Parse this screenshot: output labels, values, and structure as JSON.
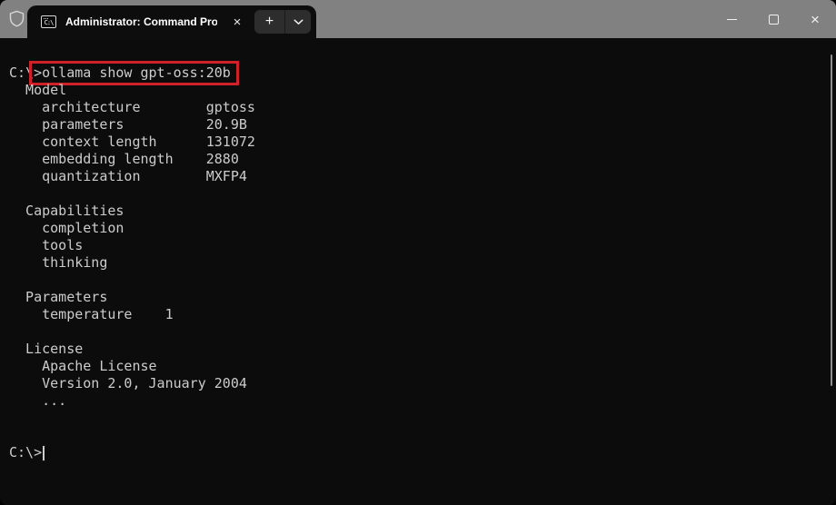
{
  "titlebar": {
    "tab": {
      "title": "Administrator: Command Pro",
      "icon": "cmd-window-icon",
      "icon_text": "C:\\",
      "close_glyph": "×"
    },
    "new_tab_glyph": "+",
    "dropdown_icon": "chevron-down-icon",
    "admin_icon": "shield-icon",
    "controls": {
      "minimize_icon": "minimize-icon",
      "maximize_icon": "maximize-icon",
      "close_glyph": "×"
    }
  },
  "terminal": {
    "prompt_prefix": "C:\\",
    "command": ">ollama show gpt-oss:20b",
    "output_text": "\n  Model\n    architecture        gptoss\n    parameters          20.9B\n    context length      131072\n    embedding length    2880\n    quantization        MXFP4\n\n  Capabilities\n    completion\n    tools\n    thinking\n\n  Parameters\n    temperature    1\n\n  License\n    Apache License\n    Version 2.0, January 2004\n    ...\n\n\n",
    "bottom_prompt": "C:\\>",
    "sections": {
      "model": {
        "architecture": "gptoss",
        "parameters": "20.9B",
        "context_length": "131072",
        "embedding_length": "2880",
        "quantization": "MXFP4"
      },
      "capabilities": [
        "completion",
        "tools",
        "thinking"
      ],
      "parameters": {
        "temperature": "1"
      },
      "license": [
        "Apache License",
        "Version 2.0, January 2004",
        "..."
      ]
    }
  },
  "colors": {
    "titlebar_gray": "#818181",
    "tab_black": "#0d0d0d",
    "terminal_bg": "#0c0c0c",
    "terminal_text": "#cccccc",
    "annotation_red": "#cf2127",
    "button_tile": "#2d2d2d"
  }
}
